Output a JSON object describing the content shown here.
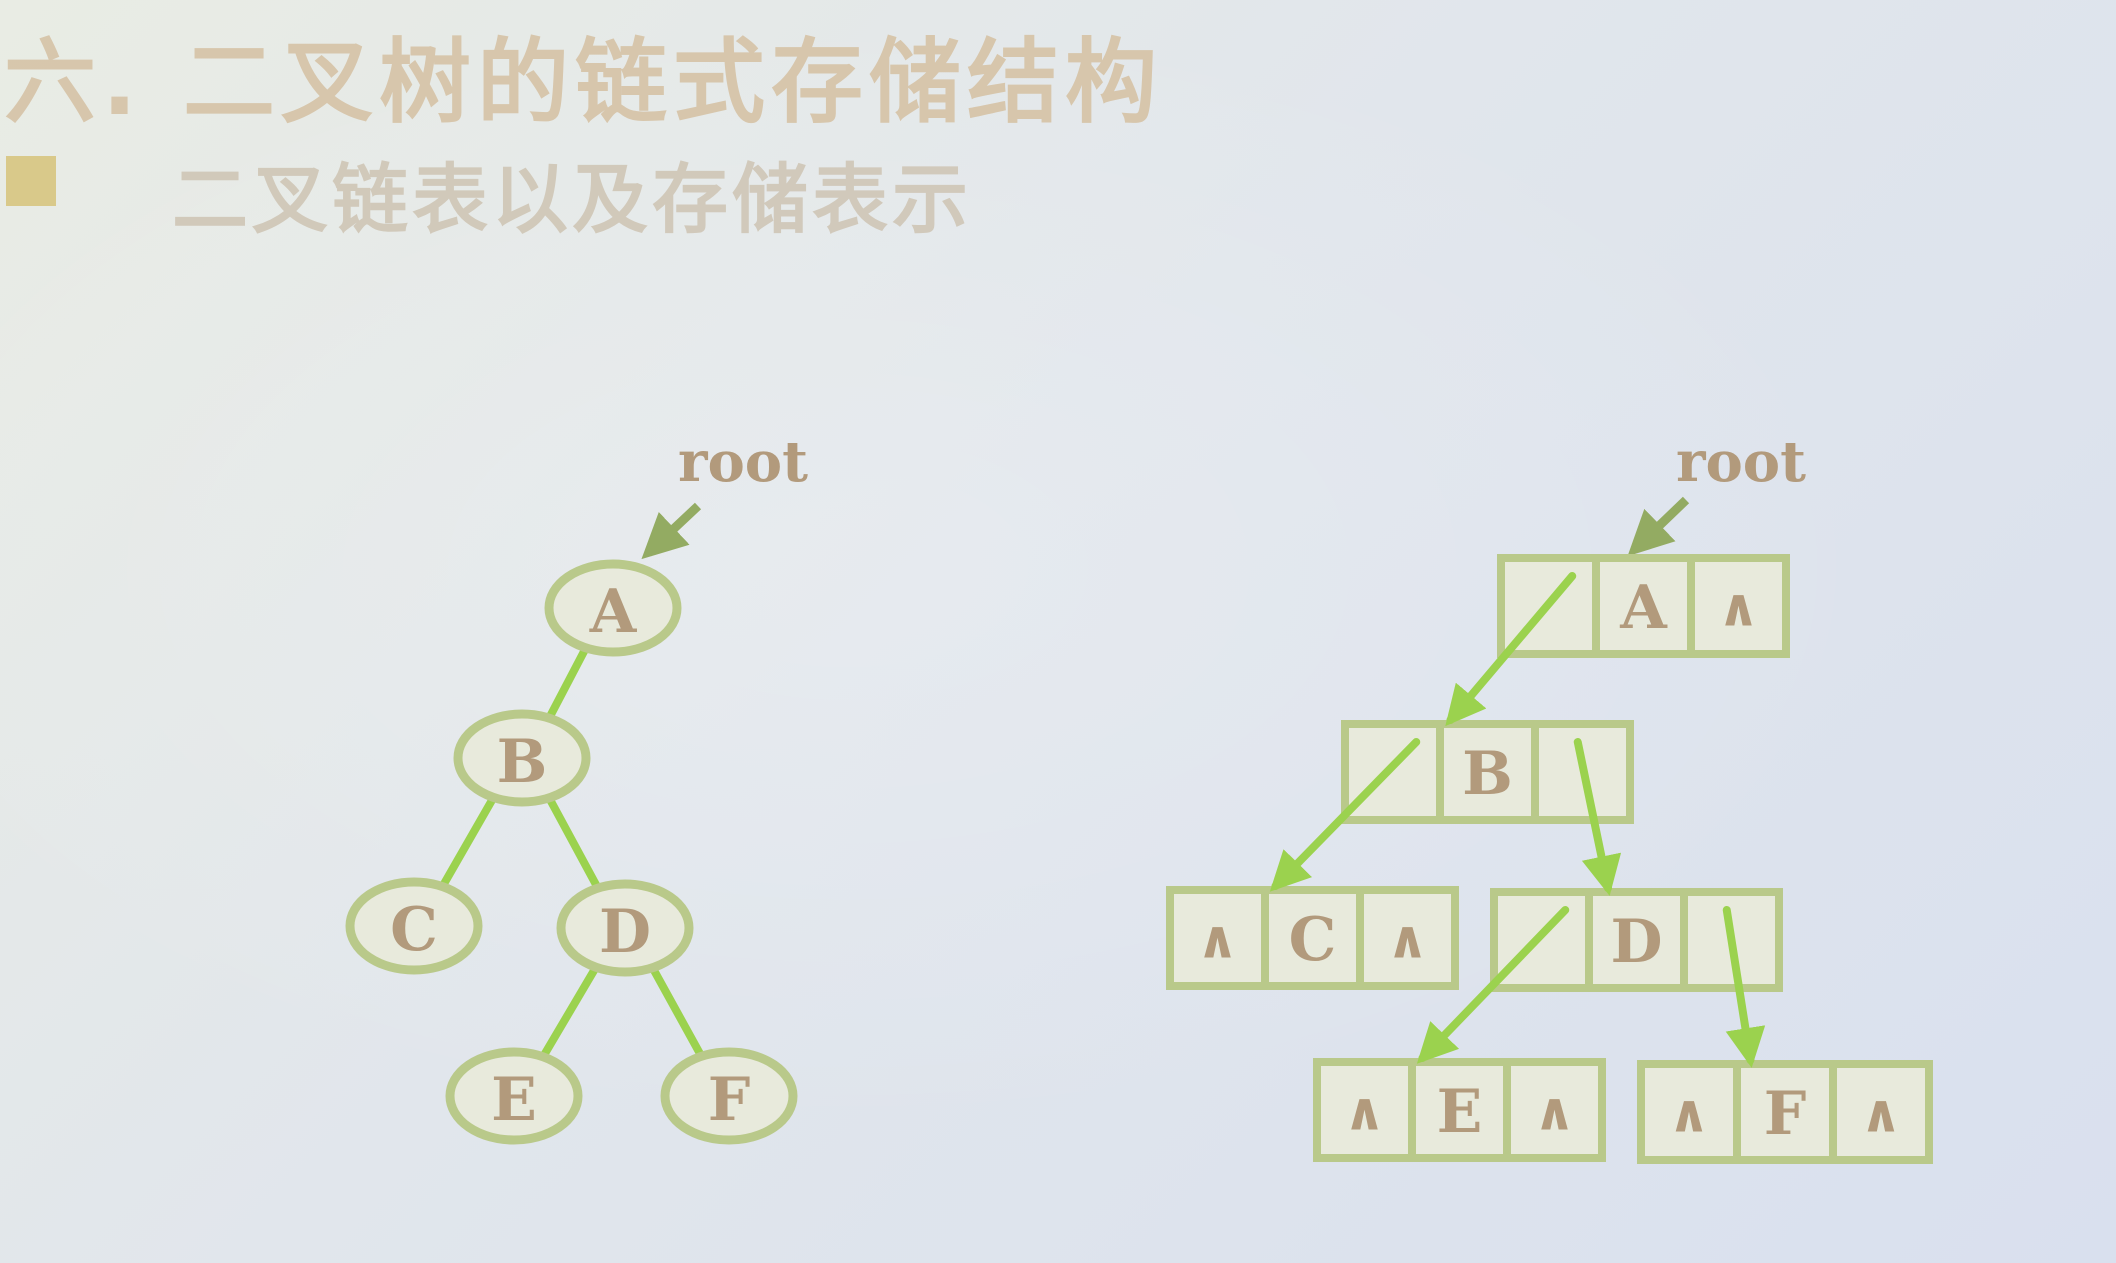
{
  "heading": {
    "number": "六.",
    "text": "二叉树的链式存储结构"
  },
  "bullet": {
    "text": "二叉链表以及存储表示"
  },
  "colors": {
    "link": "#9bd24e",
    "node_outline": "#b9c98a",
    "node_fill": "#e8eadc",
    "label": "#b29a7c",
    "arrow_dark": "#93ab62"
  },
  "tree": {
    "root_label": "root",
    "nodes": [
      {
        "id": "A",
        "label": "A"
      },
      {
        "id": "B",
        "label": "B"
      },
      {
        "id": "C",
        "label": "C"
      },
      {
        "id": "D",
        "label": "D"
      },
      {
        "id": "E",
        "label": "E"
      },
      {
        "id": "F",
        "label": "F"
      }
    ],
    "edges": [
      [
        "A",
        "B"
      ],
      [
        "B",
        "C"
      ],
      [
        "B",
        "D"
      ],
      [
        "D",
        "E"
      ],
      [
        "D",
        "F"
      ]
    ]
  },
  "linked_list": {
    "root_label": "root",
    "null_symbol": "∧",
    "nodes": [
      {
        "id": "A",
        "left": "",
        "data": "A",
        "right": "∧"
      },
      {
        "id": "B",
        "left": "",
        "data": "B",
        "right": ""
      },
      {
        "id": "C",
        "left": "∧",
        "data": "C",
        "right": "∧"
      },
      {
        "id": "D",
        "left": "",
        "data": "D",
        "right": ""
      },
      {
        "id": "E",
        "left": "∧",
        "data": "E",
        "right": "∧"
      },
      {
        "id": "F",
        "left": "∧",
        "data": "F",
        "right": "∧"
      }
    ],
    "links": [
      [
        "A",
        "left",
        "B"
      ],
      [
        "B",
        "left",
        "C"
      ],
      [
        "B",
        "right",
        "D"
      ],
      [
        "D",
        "left",
        "E"
      ],
      [
        "D",
        "right",
        "F"
      ]
    ]
  }
}
